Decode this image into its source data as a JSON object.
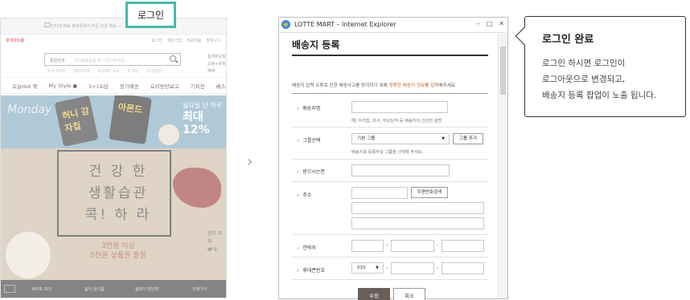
{
  "website": {
    "top_ad": "인터넷 배송 휴대폰에서 주문 당일 배송 —",
    "util_brand": "롯데마트몰",
    "util_links": [
      "로그인",
      "회원가입",
      "주문배송",
      "장바구니"
    ],
    "search_category": "통합검색",
    "search_placeholder": "반려동물용품 특가 만나보세요",
    "search_chips": [
      "혼족 필수템",
      "생활필수품",
      "로얄캐닌 사료",
      "흙 과일",
      "공기청정기"
    ],
    "side_text": [
      "컬처마운트",
      "쇼핑+문화 혜택"
    ],
    "gnb": [
      "오늘Hot 쿡",
      "My Style ●",
      "1+1&덤",
      "정기배송",
      "요리왕장보고",
      "기획전",
      "베스트"
    ],
    "hero_monday": "Monday",
    "hero_pack1": "허니 감자칩",
    "hero_pack2": "아몬드",
    "hero_sale_line1": "월요일 단 하루",
    "hero_sale_line2": "최대 12%",
    "hero_slogan": [
      "건 강 한",
      "생활습관",
      "콕! 하 라"
    ],
    "hero_promo": [
      "3만원 이상",
      "5천원 상품권 증정"
    ],
    "hero_side_label": [
      "한우 부위",
      "₩ 9,"
    ],
    "footer_items": [
      "화이트 데이",
      "봄이 왔니봄",
      "봄맞이 장단장",
      "선택기사"
    ]
  },
  "login_badge": "로그인",
  "arrow_glyph": "›",
  "popup": {
    "window_title": "LOTTE MART – Internet Explorer",
    "window_buttons": [
      "–",
      "□",
      "✕"
    ],
    "title": "배송지 등록",
    "desc_prefix": "배송지 입력 오류로 인한 배송사고를 방지하기 위해 ",
    "desc_highlight": "정확한 배송지 정보를 입력",
    "desc_suffix": "해주세요.",
    "fields": {
      "name_label": "배송지명",
      "name_value": "",
      "name_hint": "예) 우리집, 회사, 부모님댁 등 배송지의 간단한 설명",
      "group_label": "그룹선택",
      "group_value": "기본 그룹",
      "group_add": "그룹 추가",
      "group_hint": "배송지를 등록하실 그룹을 선택해 주세요.",
      "receiver_label": "받으시는분",
      "address_label": "주소",
      "zip_button": "우편번호검색",
      "phone_label": "연락처",
      "mobile_label": "휴대폰번호",
      "mobile_prefix": "010"
    },
    "ok_button": "수정",
    "cancel_button": "취소"
  },
  "callout": {
    "title": "로그인 완료",
    "lines": [
      "로그인 하시면 로그인이",
      "로그아웃으로 변경되고,",
      "배송지 등록 팝업이 노출 됩니다."
    ]
  },
  "colors": {
    "login_border": "#47b9a8",
    "popup_highlight": "#c0621c",
    "ok_button_bg": "#6b5f5c"
  }
}
